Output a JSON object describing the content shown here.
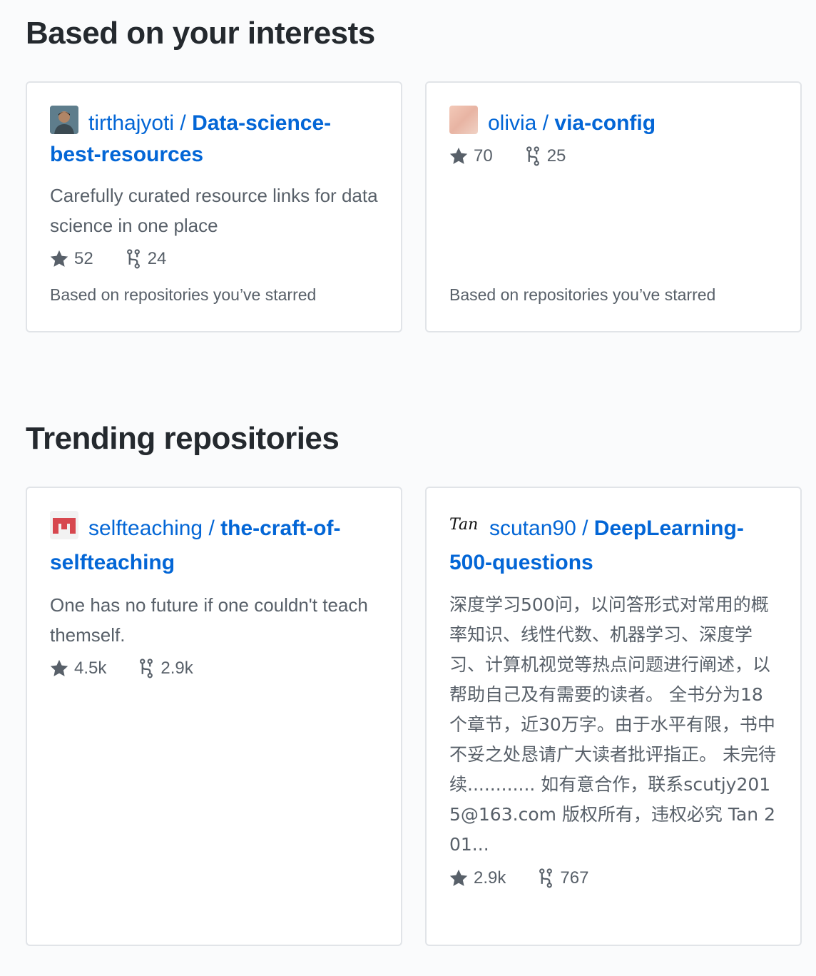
{
  "interests": {
    "title": "Based on your interests",
    "cards": [
      {
        "owner": "tirthajyoti",
        "separator": " / ",
        "repo_line1": "Data-science-",
        "repo_line2": "best-resources",
        "description": "Carefully curated resource links for data science in one place",
        "stars": "52",
        "forks": "24",
        "reason": "Based on repositories you’ve starred"
      },
      {
        "owner": "olivia",
        "separator": " / ",
        "repo": "via-config",
        "stars": "70",
        "forks": "25",
        "reason": "Based on repositories you’ve starred"
      }
    ]
  },
  "trending": {
    "title": "Trending repositories",
    "cards": [
      {
        "owner": "selfteaching",
        "separator": " / ",
        "repo_line1": "the-craft-of-",
        "repo_line2": "selfteaching",
        "description": "One has no future if one couldn't teach themself.",
        "stars": "4.5k",
        "forks": "2.9k"
      },
      {
        "owner": "scutan90",
        "separator": " / ",
        "repo_line1": "DeepLearning-",
        "repo_line2": "500-questions",
        "avatar_text": "Tan",
        "description": "深度学习500问，以问答形式对常用的概率知识、线性代数、机器学习、深度学习、计算机视觉等热点问题进行阐述，以帮助自己及有需要的读者。 全书分为18个章节，近30万字。由于水平有限，书中不妥之处恳请广大读者批评指正。 未完待续............ 如有意合作，联系scutjy2015@163.com 版权所有，违权必究 Tan 201...",
        "stars": "2.9k",
        "forks": "767"
      }
    ]
  },
  "colors": {
    "link": "#0366d6",
    "text_muted": "#586069",
    "border": "#e1e4e8"
  }
}
